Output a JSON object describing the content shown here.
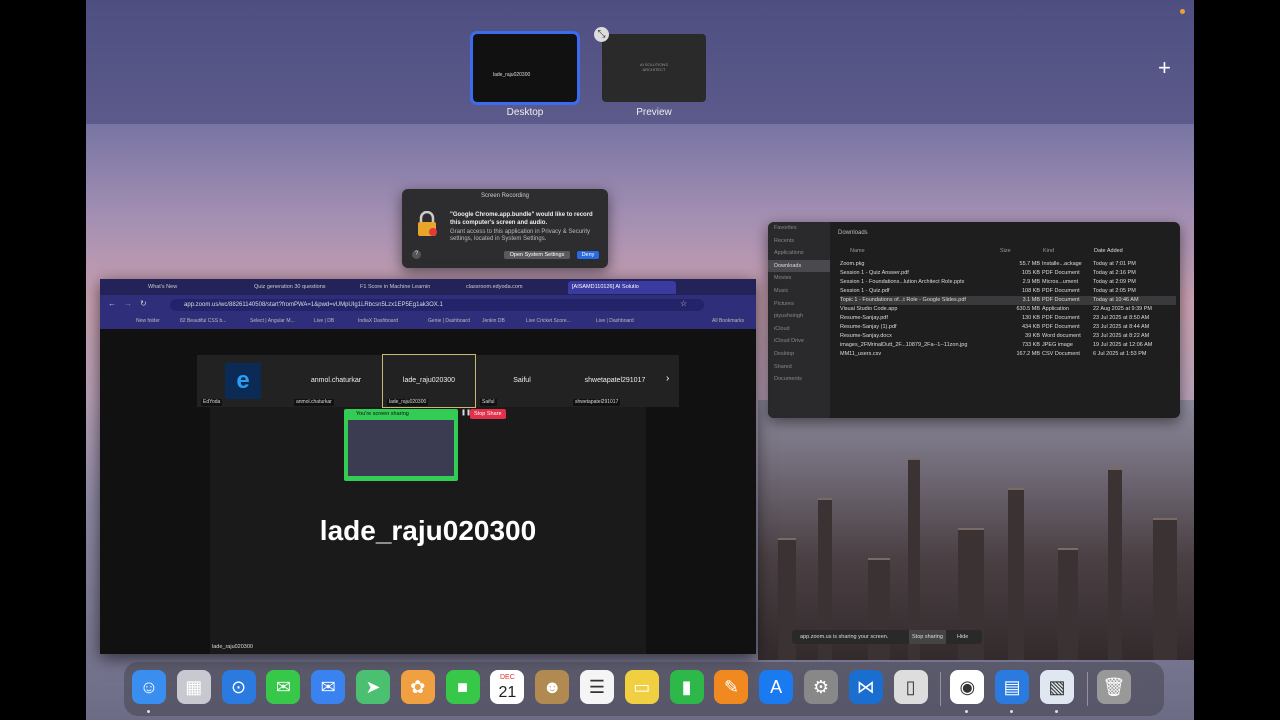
{
  "spaces": {
    "items": [
      {
        "label": "Desktop",
        "thumb_text": "lade_raju020300"
      },
      {
        "label": "Preview",
        "thumb_text": "AI SOLUTIONS ARCHITECT"
      }
    ],
    "add_icon": "plus-icon",
    "close_icon": "close-icon"
  },
  "recording_dialog": {
    "title": "Screen Recording",
    "message": "\"Google Chrome.app.bundle\" would like to record this computer's screen and audio.",
    "detail": "Grant access to this application in Privacy & Security settings, located in System Settings.",
    "open_settings": "Open System Settings",
    "deny": "Deny",
    "help": "?"
  },
  "finder": {
    "title": "Downloads",
    "sidebar": [
      "Favorites",
      "Recents",
      "Applications",
      "Downloads",
      "Movies",
      "Music",
      "Pictures",
      "piyushsingh",
      "iCloud",
      "iCloud Drive",
      "Desktop",
      "Shared",
      "Documents"
    ],
    "columns": {
      "name": "Name",
      "size": "Size",
      "kind": "Kind",
      "date": "Date Added"
    },
    "files": [
      {
        "name": "Zoom.pkg",
        "size": "55.7 MB",
        "kind": "Installe...ackage",
        "date": "Today at 7:01 PM"
      },
      {
        "name": "Session 1 - Quiz Answer.pdf",
        "size": "105 KB",
        "kind": "PDF Document",
        "date": "Today at 2:16 PM"
      },
      {
        "name": "Session 1 - Foundations...lution Architect Role.pptx",
        "size": "2.9 MB",
        "kind": "Micros...ument",
        "date": "Today at 2:09 PM"
      },
      {
        "name": "Session 1 - Quiz.pdf",
        "size": "108 KB",
        "kind": "PDF Document",
        "date": "Today at 2:05 PM"
      },
      {
        "name": "Topic 1 - Foundations of...t Role - Google Slides.pdf",
        "size": "3.1 MB",
        "kind": "PDF Document",
        "date": "Today at 10:46 AM"
      },
      {
        "name": "Visual Studio Code.app",
        "size": "630.5 MB",
        "kind": "Application",
        "date": "22 Aug 2025 at 9:39 PM"
      },
      {
        "name": "Resume-Sanjay.pdf",
        "size": "130 KB",
        "kind": "PDF Document",
        "date": "23 Jul 2025 at 8:50 AM"
      },
      {
        "name": "Resume-Sanjay (1).pdf",
        "size": "434 KB",
        "kind": "PDF Document",
        "date": "23 Jul 2025 at 8:44 AM"
      },
      {
        "name": "Resume-Sanjay.docx",
        "size": "39 KB",
        "kind": "Word document",
        "date": "23 Jul 2025 at 8:22 AM"
      },
      {
        "name": "images_2FMrinalDutt_2F...10879_2Fa--1--11zon.jpg",
        "size": "733 KB",
        "kind": "JPEG image",
        "date": "19 Jul 2025 at 12:06 AM"
      },
      {
        "name": "MM11_users.csv",
        "size": "167.2 MB",
        "kind": "CSV Document",
        "date": "6 Jul 2025 at 1:53 PM"
      }
    ]
  },
  "browser": {
    "tabs": [
      "What's New",
      "Quiz generation 30 questions",
      "F1 Score in Machine Learnin",
      "classroom.edyoda.com",
      "[AISAMD110126] AI Solutio"
    ],
    "url": "app.zoom.us/wc/88261140508/start?fromPWA=1&pwd=vUMpUIg1LRbcsn5Lzx1EP5Eg1ak3OX.1",
    "bookmarks": [
      "New folder",
      "82 Beautiful CSS b...",
      "Select | Angular M...",
      "Live | DB",
      "IndiaX Dashboard",
      "Genie | Dashboard",
      "Jenkin DB",
      "Live Cricket Score...",
      "Live | Dashboard",
      "All Bookmarks"
    ]
  },
  "zoom": {
    "participants": [
      {
        "name": "EdYoda",
        "tile": "e"
      },
      {
        "name": "anmol.chaturkar",
        "tile": "anmol.chaturkar"
      },
      {
        "name": "lade_raju020300",
        "tile": "lade_raju020300"
      },
      {
        "name": "Saiful",
        "tile": "Saiful"
      },
      {
        "name": "shwetapatel291017",
        "tile": "shwetapatel291017"
      }
    ],
    "sharing_label": "You're screen sharing",
    "stop_share": "Stop Share",
    "active_speaker": "lade_raju020300",
    "self_name": "lade_raju020300"
  },
  "share_notice": {
    "text": "app.zoom.us is sharing your screen.",
    "stop": "Stop sharing",
    "hide": "Hide"
  },
  "dock": {
    "apps": [
      "Finder",
      "Launchpad",
      "Safari",
      "Messages",
      "Mail",
      "Maps",
      "Photos",
      "FaceTime",
      "Calendar",
      "Contacts",
      "Reminders",
      "Notes",
      "Numbers",
      "Pages",
      "App Store",
      "System Settings",
      "Visual Studio Code",
      "iPhone Mirroring",
      "Google Chrome",
      "Keynote",
      "Preview",
      "Trash"
    ],
    "calendar_month": "DEC",
    "calendar_day": "21"
  }
}
